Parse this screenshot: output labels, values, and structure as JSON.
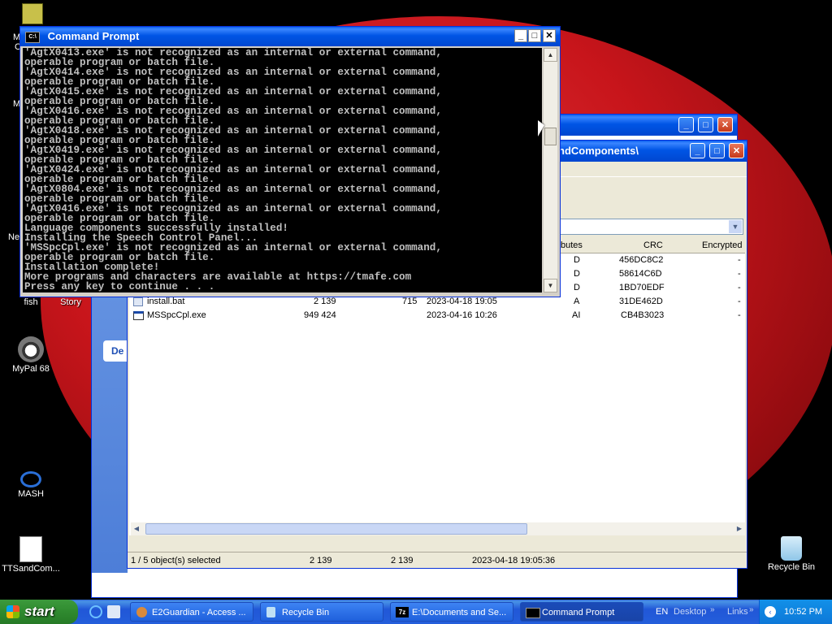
{
  "desktop": {
    "icons": [
      {
        "label": "fish"
      },
      {
        "label": "Story"
      },
      {
        "label": "MyPal 68"
      },
      {
        "label": "MASH"
      },
      {
        "label": "TTSandCom..."
      },
      {
        "label": "Recycle Bin"
      }
    ],
    "partial_labels": [
      "M",
      "C",
      "M",
      "Ne"
    ]
  },
  "cmd_window": {
    "title": "Command Prompt",
    "lines": [
      "'AgtX0413.exe' is not recognized as an internal or external command,",
      "operable program or batch file.",
      "'AgtX0414.exe' is not recognized as an internal or external command,",
      "operable program or batch file.",
      "'AgtX0415.exe' is not recognized as an internal or external command,",
      "operable program or batch file.",
      "'AgtX0416.exe' is not recognized as an internal or external command,",
      "operable program or batch file.",
      "'AgtX0418.exe' is not recognized as an internal or external command,",
      "operable program or batch file.",
      "'AgtX0419.exe' is not recognized as an internal or external command,",
      "operable program or batch file.",
      "'AgtX0424.exe' is not recognized as an internal or external command,",
      "operable program or batch file.",
      "'AgtX0804.exe' is not recognized as an internal or external command,",
      "operable program or batch file.",
      "'AgtX0416.exe' is not recognized as an internal or external command,",
      "operable program or batch file.",
      "Language components successfully installed!",
      "Installing the Speech Control Panel...",
      "'MSSpcCpl.exe' is not recognized as an internal or external command,",
      "operable program or batch file.",
      "Installation complete!",
      "More programs and characters are available at https://tmafe.com",
      "Press any key to continue . . ."
    ]
  },
  "explorer": {
    "path_fragment": "ndComponents\\",
    "side_tab": "De",
    "columns": {
      "attributes": "butes",
      "crc": "CRC",
      "encrypted": "Encrypted"
    },
    "partial_rows": [
      {
        "attr": "D",
        "crc": "456DC8C2",
        "enc": "-"
      },
      {
        "attr": "D",
        "crc": "58614C6D",
        "enc": "-"
      },
      {
        "attr": "D",
        "crc": "1BD70EDF",
        "enc": "-"
      }
    ],
    "files": [
      {
        "name": "install.bat",
        "size": "2 139",
        "packed": "715",
        "modified": "2023-04-18 19:05",
        "attr": "A",
        "crc": "31DE462D",
        "enc": "-"
      },
      {
        "name": "MSSpcCpl.exe",
        "size": "949 424",
        "packed": "",
        "modified": "2023-04-16 10:26",
        "attr": "AI",
        "crc": "CB4B3023",
        "enc": "-"
      }
    ],
    "status": {
      "selected": "1 / 5 object(s) selected",
      "size": "2 139",
      "packed": "2 139",
      "modified": "2023-04-18 19:05:36"
    }
  },
  "taskbar": {
    "start": "start",
    "tasks": [
      {
        "label": "E2Guardian - Access ..."
      },
      {
        "label": "Recycle Bin"
      },
      {
        "label": "E:\\Documents and Se..."
      },
      {
        "label": "Command Prompt"
      }
    ],
    "lang": "EN",
    "desktop": "Desktop",
    "links": "Links",
    "clock": "10:52 PM"
  },
  "colors": {
    "title_blue": "#0055e5",
    "desktop_red": "#c8151b",
    "taskbar_blue": "#245edb",
    "start_green": "#2f8a2f"
  }
}
